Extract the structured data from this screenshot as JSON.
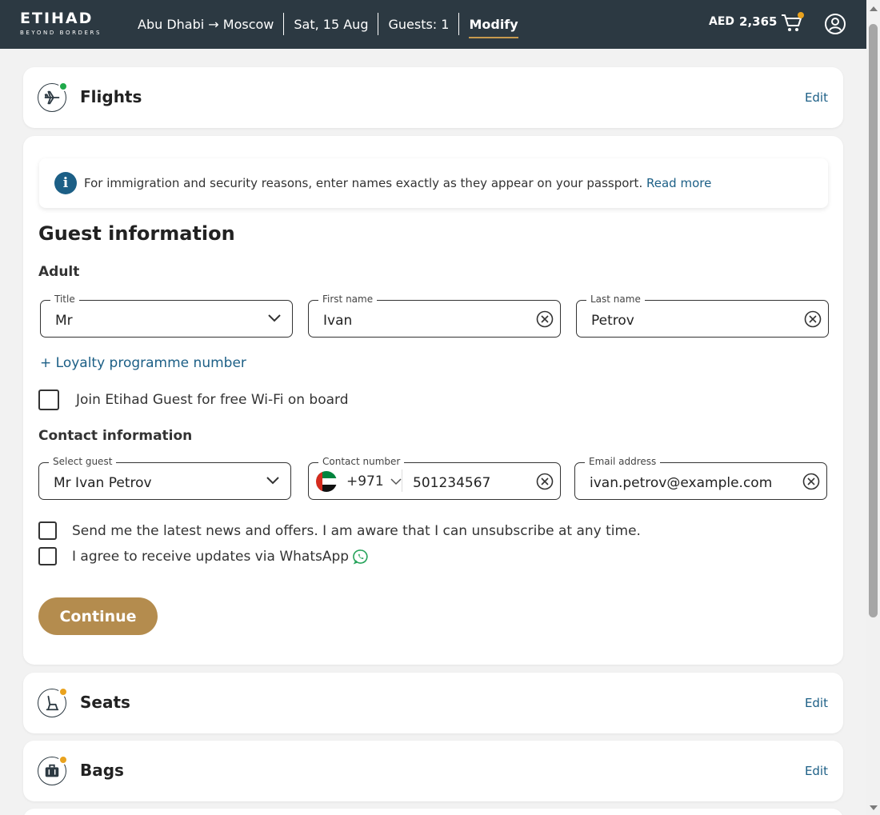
{
  "header": {
    "logo_word": "ETIHAD",
    "logo_tagline": "BEYOND BORDERS",
    "route": "Abu Dhabi → Moscow",
    "date": "Sat, 15 Aug",
    "guests": "Guests: 1",
    "modify": "Modify",
    "currency": "AED",
    "amount": "2,365"
  },
  "steps": {
    "flights": {
      "title": "Flights",
      "edit": "Edit",
      "status_color": "#1fa94a"
    },
    "seats": {
      "title": "Seats",
      "edit": "Edit",
      "status_color": "#e9a21e"
    },
    "bags": {
      "title": "Bags",
      "edit": "Edit",
      "status_color": "#e9a21e"
    }
  },
  "notice": {
    "text": "For immigration and security reasons, enter names exactly as they appear on your passport.",
    "link": "Read more"
  },
  "guest_info": {
    "title": "Guest information",
    "passenger_type": "Adult",
    "title_field": {
      "label": "Title",
      "value": "Mr"
    },
    "first_name": {
      "label": "First name",
      "value": "Ivan"
    },
    "last_name": {
      "label": "Last name",
      "value": "Petrov"
    },
    "loyalty_link": "+ Loyalty programme number",
    "join_checkbox": "Join Etihad Guest for free Wi-Fi on board"
  },
  "contact": {
    "title": "Contact information",
    "select_guest": {
      "label": "Select guest",
      "value": "Mr Ivan Petrov"
    },
    "contact_number": {
      "label": "Contact number",
      "country_code": "+971",
      "value": "501234567"
    },
    "email": {
      "label": "Email address",
      "value": "ivan.petrov@example.com"
    },
    "news_checkbox": "Send me the latest news and offers. I am aware that I can unsubscribe at any time.",
    "whatsapp_checkbox": "I agree to receive updates via WhatsApp"
  },
  "actions": {
    "continue": "Continue"
  },
  "colors": {
    "header_bg": "#2c3942",
    "accent_gold": "#b48c4e",
    "link_blue": "#1c5f86"
  }
}
